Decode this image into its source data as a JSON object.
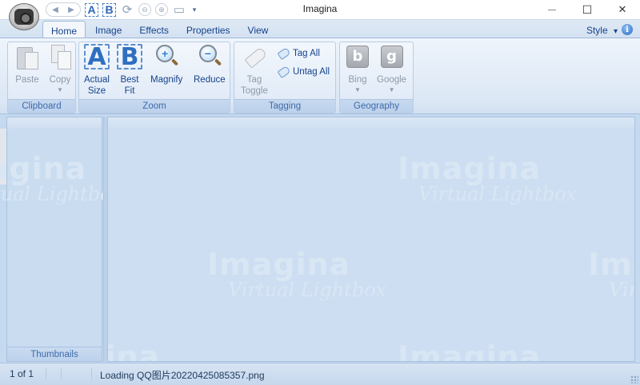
{
  "window": {
    "title": "Imagina",
    "minimize_glyph": "—",
    "maximize_glyph": "☐",
    "close_glyph": "✕"
  },
  "quick_access": {
    "back_glyph": "◀",
    "forward_glyph": "▶",
    "actual_size_letter": "A",
    "best_fit_letter": "B",
    "refresh_glyph": "⟳",
    "prev_glyph": "⊖",
    "next_glyph": "⊕",
    "save_glyph": "▭",
    "customize_glyph": "▾"
  },
  "tabs": [
    {
      "label": "Home",
      "active": true
    },
    {
      "label": "Image",
      "active": false
    },
    {
      "label": "Effects",
      "active": false
    },
    {
      "label": "Properties",
      "active": false
    },
    {
      "label": "View",
      "active": false
    }
  ],
  "style_menu": {
    "label": "Style",
    "arrow": "▾"
  },
  "info_glyph": "i",
  "ribbon": {
    "clipboard": {
      "label": "Clipboard",
      "paste": "Paste",
      "copy": "Copy",
      "dropdown": "▼"
    },
    "zoom": {
      "label": "Zoom",
      "actual_size_line1": "Actual",
      "actual_size_line2": "Size",
      "best_fit_line1": "Best",
      "best_fit_line2": "Fit",
      "magnify": "Magnify",
      "reduce": "Reduce",
      "letter_a": "A",
      "letter_b": "B",
      "plus": "+",
      "minus": "−"
    },
    "tagging": {
      "label": "Tagging",
      "tag_toggle_line1": "Tag",
      "tag_toggle_line2": "Toggle",
      "tag_all": "Tag All",
      "untag_all": "Untag All"
    },
    "geography": {
      "label": "Geography",
      "bing": "Bing",
      "google": "Google",
      "dropdown": "▼",
      "bing_letter": "b",
      "google_letter": "g"
    }
  },
  "thumbnails": {
    "label": "Thumbnails"
  },
  "watermark": {
    "line1": "Imagina",
    "line2": "Virtual Lightbox"
  },
  "status": {
    "count": "1 of 1",
    "message": "Loading QQ图片20220425085357.png"
  },
  "colors": {
    "accent": "#15428b",
    "ribbon_bg": "#dbe7f5",
    "viewer_bg": "#cddef2",
    "group_label": "#3e6aaa"
  }
}
